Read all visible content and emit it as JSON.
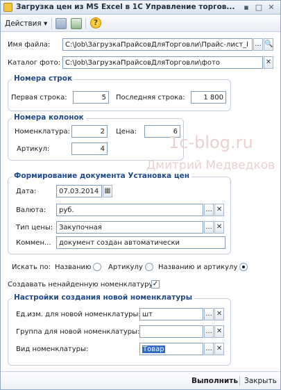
{
  "window": {
    "title": "Загрузка цен из MS Excel в 1С Управление торгов...",
    "controls": [
      "▪",
      "□",
      "✕"
    ]
  },
  "toolbar": {
    "actions_label": "Действия ▾",
    "help_label": "?"
  },
  "files": {
    "file_label": "Имя файла:",
    "file_value": "C:\\Job\\ЗагрузкаПрайсовДляТорговли\\Прайс-лист_l",
    "photo_label": "Каталог фото:",
    "photo_value": "C:\\Job\\ЗагрузкаПрайсовДляТорговли\\фото"
  },
  "rows_group": {
    "title": "Номера строк",
    "first_label": "Первая строка:",
    "first_value": "5",
    "last_label": "Последняя строка:",
    "last_value": "1 800"
  },
  "cols_group": {
    "title": "Номера колонок",
    "nomenclature_label": "Номенклатура:",
    "nomenclature_value": "2",
    "price_label": "Цена:",
    "price_value": "6",
    "article_label": "Артикул:",
    "article_value": "4"
  },
  "watermark": {
    "line1": "1c-blog.ru",
    "line2": "Дмитрий Медведков"
  },
  "doc_group": {
    "title": "Формирование документа Установка цен",
    "date_label": "Дата:",
    "date_value": "07.03.2014",
    "currency_label": "Валюта:",
    "currency_value": "руб.",
    "price_type_label": "Тип цены:",
    "price_type_value": "Закупочная",
    "comment_label": "Коммен...",
    "comment_value": "документ создан автоматически"
  },
  "search": {
    "label": "Искать по:",
    "options": [
      "Названию",
      "Артикулу",
      "Названию и артикулу"
    ],
    "selected_index": 2
  },
  "create_missing": {
    "label": "Создавать ненайденную номенклатуру",
    "checked": true,
    "mark": "✓"
  },
  "settings_group": {
    "title": "Настройки создания новой номенклатуры",
    "unit_label": "Ед.изм. для новой номенклатуры:",
    "unit_value": "шт",
    "group_label": "Группа для новой номенклатуры:",
    "group_value": "",
    "kind_label": "Вид номенклатуры:",
    "kind_value": "Товар"
  },
  "footer": {
    "run_label": "Выполнить",
    "close_label": "Закрыть"
  },
  "icons": {
    "select": "...",
    "search": "🔍",
    "clear": "✕",
    "calendar": "▦"
  }
}
